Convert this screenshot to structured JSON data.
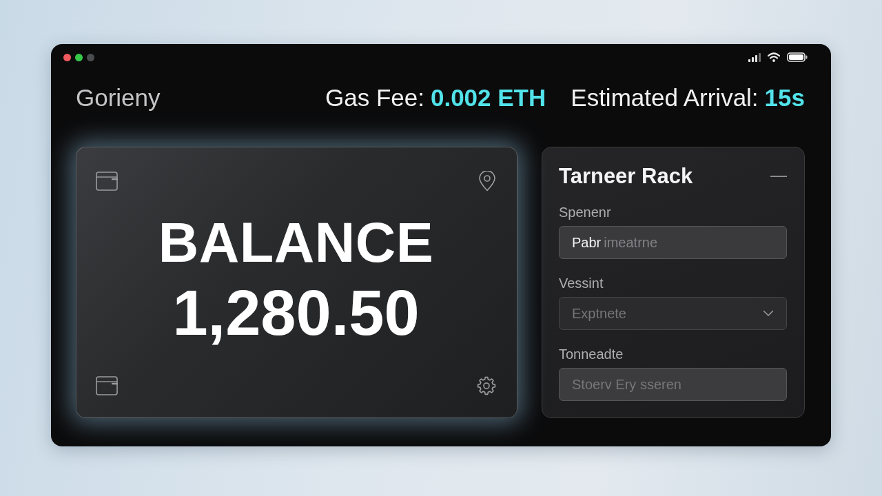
{
  "header": {
    "brand": "Gorieny",
    "gas_fee": {
      "label": "Gas Fee:",
      "value": "0.002 ETH"
    },
    "arrival": {
      "label": "Estimated Arrival:",
      "value": "15s"
    }
  },
  "balance_card": {
    "label": "BALANCE",
    "amount": "1,280.50"
  },
  "panel": {
    "title": "Tarneer Rack",
    "fields": [
      {
        "kind": "text",
        "label": "Spenenr",
        "value": "Pabr",
        "suggestion": "imeatrne"
      },
      {
        "kind": "select",
        "label": "Vessint",
        "placeholder": "Exptnete"
      },
      {
        "kind": "text",
        "label": "Tonneadte",
        "placeholder": "Stoerv Ery sseren"
      }
    ]
  }
}
